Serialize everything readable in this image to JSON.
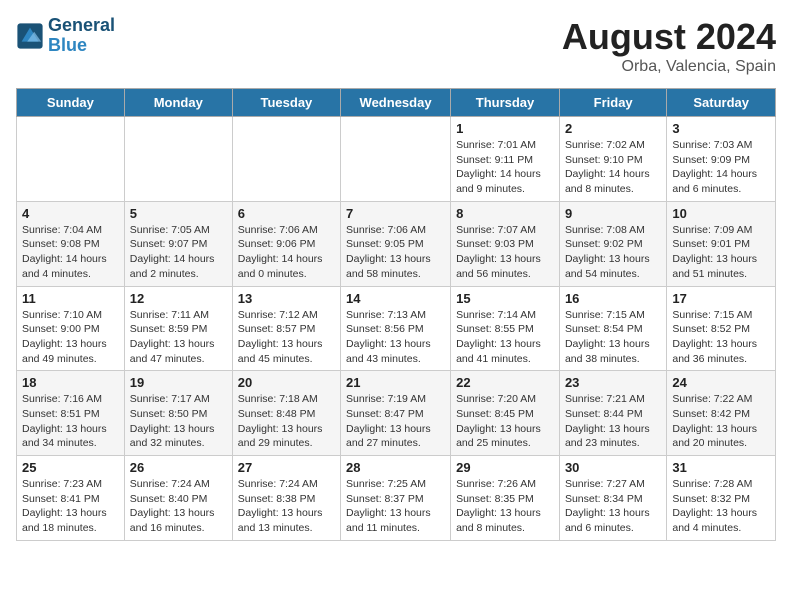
{
  "header": {
    "logo_line1": "General",
    "logo_line2": "Blue",
    "month_year": "August 2024",
    "location": "Orba, Valencia, Spain"
  },
  "days_of_week": [
    "Sunday",
    "Monday",
    "Tuesday",
    "Wednesday",
    "Thursday",
    "Friday",
    "Saturday"
  ],
  "weeks": [
    [
      {
        "day": "",
        "info": ""
      },
      {
        "day": "",
        "info": ""
      },
      {
        "day": "",
        "info": ""
      },
      {
        "day": "",
        "info": ""
      },
      {
        "day": "1",
        "info": "Sunrise: 7:01 AM\nSunset: 9:11 PM\nDaylight: 14 hours\nand 9 minutes."
      },
      {
        "day": "2",
        "info": "Sunrise: 7:02 AM\nSunset: 9:10 PM\nDaylight: 14 hours\nand 8 minutes."
      },
      {
        "day": "3",
        "info": "Sunrise: 7:03 AM\nSunset: 9:09 PM\nDaylight: 14 hours\nand 6 minutes."
      }
    ],
    [
      {
        "day": "4",
        "info": "Sunrise: 7:04 AM\nSunset: 9:08 PM\nDaylight: 14 hours\nand 4 minutes."
      },
      {
        "day": "5",
        "info": "Sunrise: 7:05 AM\nSunset: 9:07 PM\nDaylight: 14 hours\nand 2 minutes."
      },
      {
        "day": "6",
        "info": "Sunrise: 7:06 AM\nSunset: 9:06 PM\nDaylight: 14 hours\nand 0 minutes."
      },
      {
        "day": "7",
        "info": "Sunrise: 7:06 AM\nSunset: 9:05 PM\nDaylight: 13 hours\nand 58 minutes."
      },
      {
        "day": "8",
        "info": "Sunrise: 7:07 AM\nSunset: 9:03 PM\nDaylight: 13 hours\nand 56 minutes."
      },
      {
        "day": "9",
        "info": "Sunrise: 7:08 AM\nSunset: 9:02 PM\nDaylight: 13 hours\nand 54 minutes."
      },
      {
        "day": "10",
        "info": "Sunrise: 7:09 AM\nSunset: 9:01 PM\nDaylight: 13 hours\nand 51 minutes."
      }
    ],
    [
      {
        "day": "11",
        "info": "Sunrise: 7:10 AM\nSunset: 9:00 PM\nDaylight: 13 hours\nand 49 minutes."
      },
      {
        "day": "12",
        "info": "Sunrise: 7:11 AM\nSunset: 8:59 PM\nDaylight: 13 hours\nand 47 minutes."
      },
      {
        "day": "13",
        "info": "Sunrise: 7:12 AM\nSunset: 8:57 PM\nDaylight: 13 hours\nand 45 minutes."
      },
      {
        "day": "14",
        "info": "Sunrise: 7:13 AM\nSunset: 8:56 PM\nDaylight: 13 hours\nand 43 minutes."
      },
      {
        "day": "15",
        "info": "Sunrise: 7:14 AM\nSunset: 8:55 PM\nDaylight: 13 hours\nand 41 minutes."
      },
      {
        "day": "16",
        "info": "Sunrise: 7:15 AM\nSunset: 8:54 PM\nDaylight: 13 hours\nand 38 minutes."
      },
      {
        "day": "17",
        "info": "Sunrise: 7:15 AM\nSunset: 8:52 PM\nDaylight: 13 hours\nand 36 minutes."
      }
    ],
    [
      {
        "day": "18",
        "info": "Sunrise: 7:16 AM\nSunset: 8:51 PM\nDaylight: 13 hours\nand 34 minutes."
      },
      {
        "day": "19",
        "info": "Sunrise: 7:17 AM\nSunset: 8:50 PM\nDaylight: 13 hours\nand 32 minutes."
      },
      {
        "day": "20",
        "info": "Sunrise: 7:18 AM\nSunset: 8:48 PM\nDaylight: 13 hours\nand 29 minutes."
      },
      {
        "day": "21",
        "info": "Sunrise: 7:19 AM\nSunset: 8:47 PM\nDaylight: 13 hours\nand 27 minutes."
      },
      {
        "day": "22",
        "info": "Sunrise: 7:20 AM\nSunset: 8:45 PM\nDaylight: 13 hours\nand 25 minutes."
      },
      {
        "day": "23",
        "info": "Sunrise: 7:21 AM\nSunset: 8:44 PM\nDaylight: 13 hours\nand 23 minutes."
      },
      {
        "day": "24",
        "info": "Sunrise: 7:22 AM\nSunset: 8:42 PM\nDaylight: 13 hours\nand 20 minutes."
      }
    ],
    [
      {
        "day": "25",
        "info": "Sunrise: 7:23 AM\nSunset: 8:41 PM\nDaylight: 13 hours\nand 18 minutes."
      },
      {
        "day": "26",
        "info": "Sunrise: 7:24 AM\nSunset: 8:40 PM\nDaylight: 13 hours\nand 16 minutes."
      },
      {
        "day": "27",
        "info": "Sunrise: 7:24 AM\nSunset: 8:38 PM\nDaylight: 13 hours\nand 13 minutes."
      },
      {
        "day": "28",
        "info": "Sunrise: 7:25 AM\nSunset: 8:37 PM\nDaylight: 13 hours\nand 11 minutes."
      },
      {
        "day": "29",
        "info": "Sunrise: 7:26 AM\nSunset: 8:35 PM\nDaylight: 13 hours\nand 8 minutes."
      },
      {
        "day": "30",
        "info": "Sunrise: 7:27 AM\nSunset: 8:34 PM\nDaylight: 13 hours\nand 6 minutes."
      },
      {
        "day": "31",
        "info": "Sunrise: 7:28 AM\nSunset: 8:32 PM\nDaylight: 13 hours\nand 4 minutes."
      }
    ]
  ]
}
